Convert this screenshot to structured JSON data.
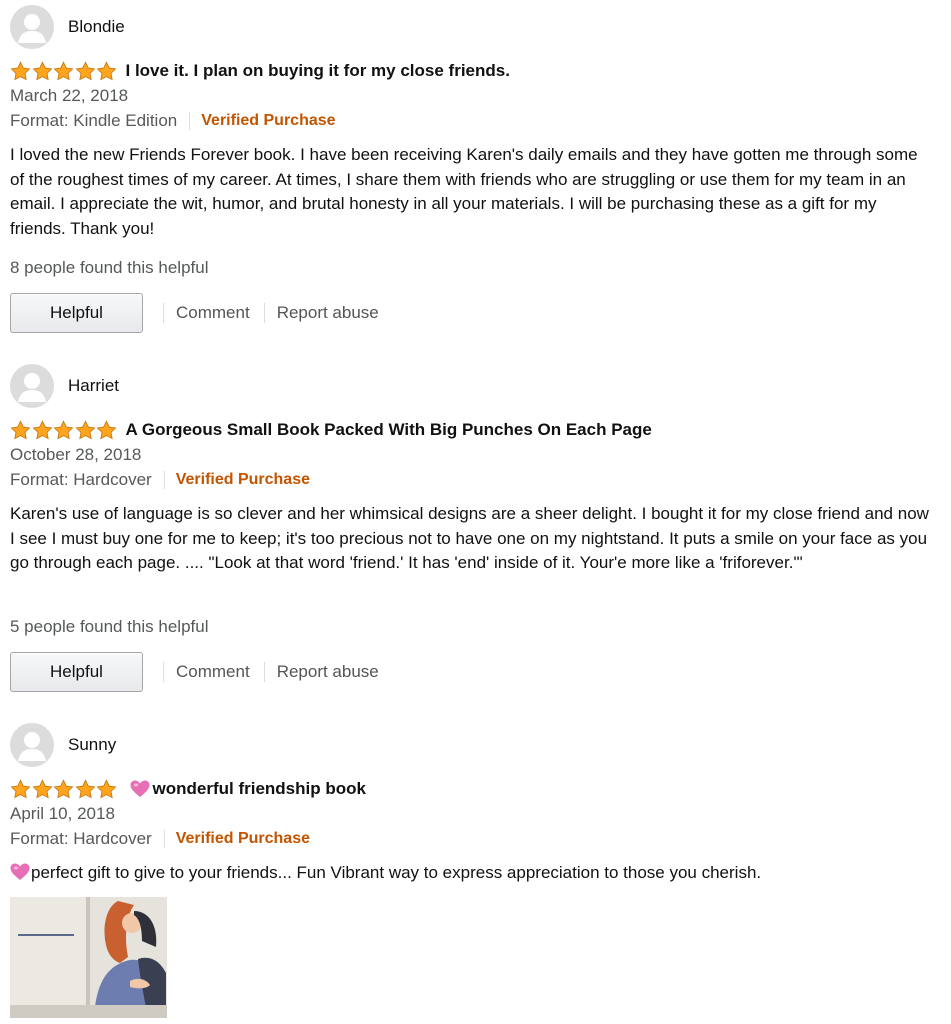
{
  "helpful_button_label": "Helpful",
  "comment_label": "Comment",
  "report_label": "Report abuse",
  "colors": {
    "star": "#ffa41c",
    "verified": "#c45500",
    "heart": "#e66fb5"
  },
  "reviews": [
    {
      "author": "Blondie",
      "rating": 5,
      "title_prefix_icon": "",
      "title": "I love it. I plan on buying it for my close friends.",
      "date": "March 22, 2018",
      "format": "Format: Kindle Edition",
      "verified": "Verified Purchase",
      "body": "I loved the new Friends Forever book. I have been receiving Karen's daily emails and they have gotten me through some of the roughest times of my career. At times, I share them with friends who are struggling or use them for my team in an email. I appreciate the wit, humor, and brutal honesty in all your materials. I will be purchasing these as a gift for my friends. Thank you!",
      "helpful_count": "8 people found this helpful"
    },
    {
      "author": "Harriet",
      "rating": 5,
      "title_prefix_icon": "",
      "title": "A Gorgeous Small Book Packed With Big Punches On Each Page",
      "date": "October 28, 2018",
      "format": "Format: Hardcover",
      "verified": "Verified Purchase",
      "body": "Karen's use of language is so clever and her whimsical designs are a sheer delight. I bought it for my close friend and now I see I must buy one for me to keep; it's too precious not to have one on my nightstand. It puts a smile on your face as you go through each page. .... \"Look at that word 'friend.' It has 'end' inside of it. Your'e more like a 'friforever.'\"",
      "helpful_count": "5 people found this helpful"
    },
    {
      "author": "Sunny",
      "rating": 5,
      "title_prefix_icon": "pink-heart-icon",
      "title": "wonderful friendship book",
      "date": "April 10, 2018",
      "format": "Format: Hardcover",
      "verified": "Verified Purchase",
      "body_prefix_icon": "pink-heart-icon",
      "body": "perfect gift to give to your friends... Fun Vibrant way to express appreciation to those you cherish."
    }
  ]
}
